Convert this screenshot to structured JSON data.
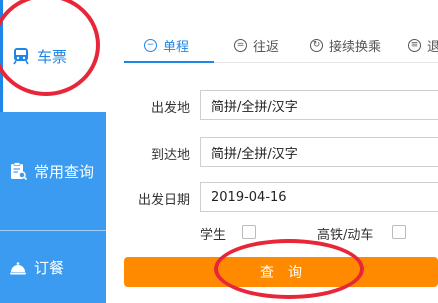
{
  "sidebar": {
    "items": [
      {
        "label": "车票",
        "icon": "train-icon",
        "active": true
      },
      {
        "label": "常用查询",
        "icon": "clipboard-search-icon"
      },
      {
        "label": "订餐",
        "icon": "meal-bell-icon"
      }
    ]
  },
  "tabs": [
    {
      "label": "单程",
      "icon": "minus-circle-icon",
      "active": true
    },
    {
      "label": "往返",
      "icon": "equals-circle-icon"
    },
    {
      "label": "接续换乘",
      "icon": "transfer-circle-icon"
    },
    {
      "label": "退",
      "icon": "list-circle-icon"
    }
  ],
  "form": {
    "from_label": "出发地",
    "from_value": "简拼/全拼/汉字",
    "to_label": "到达地",
    "to_value": "简拼/全拼/汉字",
    "date_label": "出发日期",
    "date_value": "2019-04-16",
    "student_label": "学生",
    "highspeed_label": "高铁/动车"
  },
  "search_label": "查询",
  "colors": {
    "accent": "#1e86e6",
    "sidebar_bg": "#3b9bf0",
    "button": "#ff8a00",
    "annotation": "#e8263a"
  }
}
